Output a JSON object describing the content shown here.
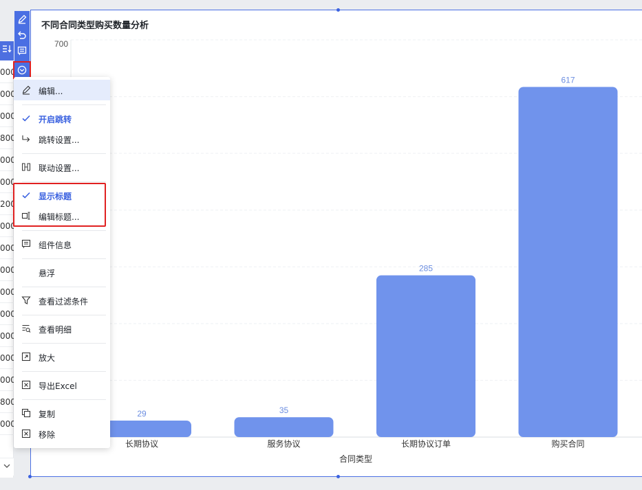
{
  "chart": {
    "title": "不同合同类型购买数量分析",
    "y_top_tick": "700",
    "x_axis_label": "合同类型"
  },
  "chart_data": {
    "type": "bar",
    "title": "不同合同类型购买数量分析",
    "xlabel": "合同类型",
    "ylabel": "",
    "categories": [
      "长期协议",
      "服务协议",
      "长期协议订单",
      "购买合同"
    ],
    "values": [
      29,
      35,
      285,
      617
    ],
    "ylim": [
      0,
      700
    ],
    "yticks_visible": [
      "700"
    ],
    "grid": true,
    "bar_color": "#7093ec",
    "label_color": "#6b8de0"
  },
  "toolbar": {
    "items": [
      {
        "name": "edit-pen-icon",
        "label": ""
      },
      {
        "name": "undo-icon",
        "label": ""
      },
      {
        "name": "comment-icon",
        "label": ""
      },
      {
        "name": "more-options-icon",
        "label": ""
      }
    ]
  },
  "menu": {
    "items": [
      {
        "key": "edit",
        "label": "编辑...",
        "icon": "pencil-icon",
        "checked": false,
        "active": true
      },
      {
        "key": "enable-jump",
        "label": "开启跳转",
        "icon": "check-icon",
        "checked": true,
        "active": false
      },
      {
        "key": "jump-settings",
        "label": "跳转设置...",
        "icon": "redirect-arrow-icon",
        "checked": false,
        "active": false
      },
      {
        "key": "linkage-settings",
        "label": "联动设置...",
        "icon": "linkage-icon",
        "checked": false,
        "active": false
      },
      {
        "key": "show-title",
        "label": "显示标题",
        "icon": "check-icon",
        "checked": true,
        "active": false
      },
      {
        "key": "edit-title",
        "label": "编辑标题...",
        "icon": "edit-title-icon",
        "checked": false,
        "active": false
      },
      {
        "key": "component-info",
        "label": "组件信息",
        "icon": "info-doc-icon",
        "checked": false,
        "active": false
      },
      {
        "key": "float",
        "label": "悬浮",
        "icon": "",
        "checked": false,
        "active": false
      },
      {
        "key": "view-filter",
        "label": "查看过滤条件",
        "icon": "filter-icon",
        "checked": false,
        "active": false
      },
      {
        "key": "view-detail",
        "label": "查看明细",
        "icon": "detail-search-icon",
        "checked": false,
        "active": false
      },
      {
        "key": "enlarge",
        "label": "放大",
        "icon": "expand-icon",
        "checked": false,
        "active": false
      },
      {
        "key": "export-excel",
        "label": "导出Excel",
        "icon": "excel-icon",
        "checked": false,
        "active": false
      },
      {
        "key": "copy",
        "label": "复制",
        "icon": "copy-icon",
        "checked": false,
        "active": false
      },
      {
        "key": "remove",
        "label": "移除",
        "icon": "remove-box-icon",
        "checked": false,
        "active": false
      }
    ]
  },
  "left_table": {
    "head_icon": "sort-list-icon",
    "cells": [
      "000",
      "000",
      "000",
      "800",
      "000",
      "000",
      "200",
      "000",
      "000",
      "000",
      "000",
      "000",
      "000",
      "000",
      "000",
      "800",
      "000"
    ]
  },
  "colors": {
    "accent": "#4a6fe3",
    "bar": "#7093ec",
    "highlight": "#e02020"
  }
}
